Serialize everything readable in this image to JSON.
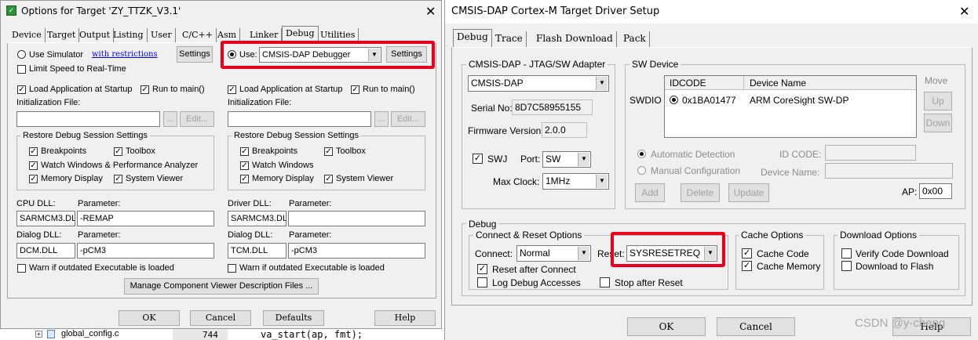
{
  "left": {
    "title": "Options for Target 'ZY_TTZK_V3.1'",
    "tabs": [
      "Device",
      "Target",
      "Output",
      "Listing",
      "User",
      "C/C++",
      "Asm",
      "Linker",
      "Debug",
      "Utilities"
    ],
    "sim": {
      "use_simulator": "Use Simulator",
      "with_restrictions": "with restrictions",
      "settings": "Settings",
      "limit_speed": "Limit Speed to Real-Time",
      "load_app": "Load Application at Startup",
      "run_to_main": "Run to main()",
      "init_file": "Initialization File:",
      "edit": "Edit...",
      "dots": "...",
      "restore": "Restore Debug Session Settings",
      "breakpoints": "Breakpoints",
      "toolbox": "Toolbox",
      "watch": "Watch Windows & Performance Analyzer",
      "memory": "Memory Display",
      "sysviewer": "System Viewer",
      "cpu_dll_label": "CPU DLL:",
      "parameter": "Parameter:",
      "cpu_dll": "SARMCM3.DLL",
      "cpu_param": "-REMAP",
      "dialog_dll_label": "Dialog DLL:",
      "dialog_dll": "DCM.DLL",
      "dialog_param": "-pCM3",
      "warn": "Warn if outdated Executable is loaded"
    },
    "tgt": {
      "use": "Use:",
      "debugger": "CMSIS-DAP Debugger",
      "settings": "Settings",
      "load_app": "Load Application at Startup",
      "run_to_main": "Run to main()",
      "init_file": "Initialization File:",
      "edit": "Edit...",
      "dots": "...",
      "restore": "Restore Debug Session Settings",
      "breakpoints": "Breakpoints",
      "toolbox": "Toolbox",
      "watch": "Watch Windows",
      "memory": "Memory Display",
      "sysviewer": "System Viewer",
      "driver_dll_label": "Driver DLL:",
      "parameter": "Parameter:",
      "driver_dll": "SARMCM3.DLL",
      "driver_param": "",
      "dialog_dll_label": "Dialog DLL:",
      "dialog_dll": "TCM.DLL",
      "dialog_param": "-pCM3",
      "warn": "Warn if outdated Executable is loaded"
    },
    "manage": "Manage Component Viewer Description Files ...",
    "buttons": {
      "ok": "OK",
      "cancel": "Cancel",
      "defaults": "Defaults",
      "help": "Help"
    },
    "behind": {
      "file": "global_config.c",
      "line": "744",
      "code": "va_start(ap, fmt);"
    }
  },
  "right": {
    "title": "CMSIS-DAP Cortex-M Target Driver Setup",
    "tabs": [
      "Debug",
      "Trace",
      "Flash Download",
      "Pack"
    ],
    "adapter": {
      "group": "CMSIS-DAP - JTAG/SW Adapter",
      "device": "CMSIS-DAP",
      "serial_label": "Serial No:",
      "serial": "8D7C58955155",
      "fw_label": "Firmware Version:",
      "fw": "2.0.0",
      "swj": "SWJ",
      "port_label": "Port:",
      "port": "SW",
      "clock_label": "Max Clock:",
      "clock": "1MHz"
    },
    "swdev": {
      "group": "SW Device",
      "col_idcode": "IDCODE",
      "col_name": "Device Name",
      "swdio": "SWDIO",
      "row_idcode": "0x1BA01477",
      "row_name": "ARM CoreSight SW-DP",
      "move": "Move",
      "up": "Up",
      "down": "Down",
      "auto": "Automatic Detection",
      "manual": "Manual Configuration",
      "idcode_label": "ID CODE:",
      "devname_label": "Device Name:",
      "add": "Add",
      "delete": "Delete",
      "update": "Update",
      "ap_label": "AP:",
      "ap": "0x00"
    },
    "debug": {
      "group": "Debug",
      "conn_group": "Connect & Reset Options",
      "connect_label": "Connect:",
      "connect": "Normal",
      "reset_label": "Reset:",
      "reset": "SYSRESETREQ",
      "reset_after": "Reset after Connect",
      "log_access": "Log Debug Accesses",
      "stop_after": "Stop after Reset",
      "cache_group": "Cache Options",
      "cache_code": "Cache Code",
      "cache_mem": "Cache Memory",
      "dl_group": "Download Options",
      "verify": "Verify Code Download",
      "dl_flash": "Download to Flash"
    },
    "buttons": {
      "ok": "OK",
      "cancel": "Cancel",
      "help": "Help"
    },
    "watermark": "CSDN @y-cheng"
  },
  "colors": {
    "highlight": "#e8001c",
    "link": "#0000ff",
    "dialog_bg": "#f0f0f0"
  }
}
